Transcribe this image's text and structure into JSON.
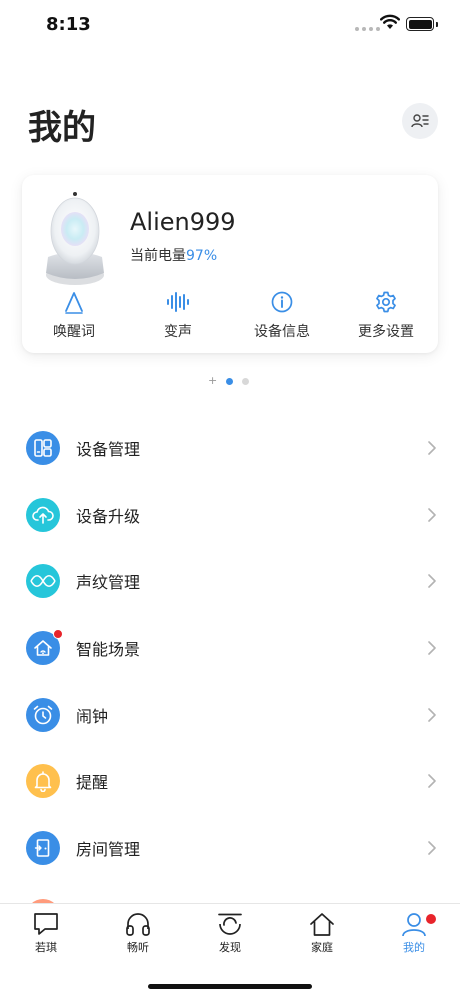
{
  "status_bar": {
    "time": "8:13"
  },
  "header": {
    "title": "我的"
  },
  "device": {
    "name": "Alien999",
    "battery_label": "当前电量",
    "battery_percent": "97%",
    "actions": [
      {
        "label": "唤醒词",
        "icon": "wake-word-icon"
      },
      {
        "label": "变声",
        "icon": "voice-wave-icon"
      },
      {
        "label": "设备信息",
        "icon": "info-icon"
      },
      {
        "label": "更多设置",
        "icon": "gear-icon"
      }
    ]
  },
  "pager": {
    "pages": 2,
    "active": 0
  },
  "menu": [
    {
      "label": "设备管理",
      "icon": "device-grid-icon",
      "color": "#3a8ee6"
    },
    {
      "label": "设备升级",
      "icon": "cloud-upload-icon",
      "color": "#26c6da"
    },
    {
      "label": "声纹管理",
      "icon": "voiceprint-icon",
      "color": "#26c6da"
    },
    {
      "label": "智能场景",
      "icon": "smart-home-icon",
      "color": "#3a8ee6",
      "badge": true
    },
    {
      "label": "闹钟",
      "icon": "alarm-clock-icon",
      "color": "#3a8ee6"
    },
    {
      "label": "提醒",
      "icon": "bell-icon",
      "color": "#ffc04d"
    },
    {
      "label": "房间管理",
      "icon": "door-icon",
      "color": "#3a8ee6"
    }
  ],
  "tabs": [
    {
      "label": "若琪",
      "icon": "chat-icon",
      "active": false
    },
    {
      "label": "畅听",
      "icon": "headphones-icon",
      "active": false
    },
    {
      "label": "发现",
      "icon": "discover-icon",
      "active": false
    },
    {
      "label": "家庭",
      "icon": "house-icon",
      "active": false
    },
    {
      "label": "我的",
      "icon": "person-icon",
      "active": true,
      "badge": true
    }
  ],
  "colors": {
    "accent": "#3a8ee6",
    "badge": "#e8242b"
  }
}
